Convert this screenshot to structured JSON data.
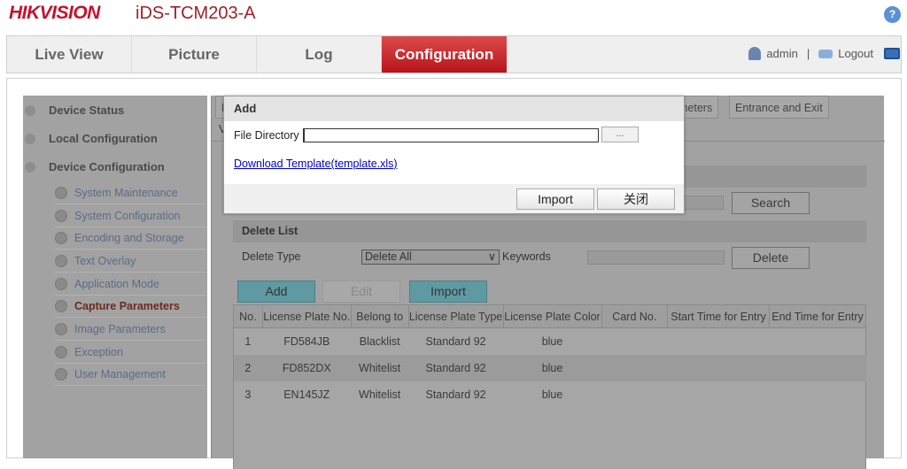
{
  "header": {
    "brand": "HIKVISION",
    "model": "iDS-TCM203-A",
    "help": "?"
  },
  "nav": {
    "tabs": [
      "Live View",
      "Picture",
      "Log",
      "Configuration"
    ],
    "active": "Configuration",
    "user": "admin",
    "separator": "|",
    "logout": "Logout"
  },
  "sidebar": {
    "groups": [
      "Device Status",
      "Local Configuration",
      "Device Configuration"
    ],
    "items": [
      "System Maintenance",
      "System Configuration",
      "Encoding and Storage",
      "Text Overlay",
      "Application Mode",
      "Capture Parameters",
      "Image Parameters",
      "Exception",
      "User Management"
    ],
    "active": "Capture Parameters"
  },
  "main": {
    "tabs": [
      "L",
      "meters",
      "Entrance and Exit"
    ],
    "tab_row2": "V",
    "search_button": "Search",
    "delete_list": {
      "title": "Delete List",
      "delete_type_label": "Delete Type",
      "delete_type_value": "Delete All",
      "keywords_label": "Keywords",
      "delete_button": "Delete"
    },
    "actions": {
      "add": "Add",
      "edit": "Edit",
      "import": "Import"
    },
    "table": {
      "columns": [
        "No.",
        "License Plate No.",
        "Belong to",
        "License Plate Type",
        "License Plate Color",
        "Card No.",
        "Start Time for Entry",
        "End Time for Entry"
      ],
      "rows": [
        [
          "1",
          "FD584JB",
          "Blacklist",
          "Standard 92",
          "blue",
          "",
          "",
          ""
        ],
        [
          "2",
          "FD852DX",
          "Whitelist",
          "Standard 92",
          "blue",
          "",
          "",
          ""
        ],
        [
          "3",
          "EN145JZ",
          "Whitelist",
          "Standard 92",
          "blue",
          "",
          "",
          ""
        ]
      ]
    }
  },
  "modal": {
    "title": "Add",
    "file_directory_label": "File Directory",
    "file_directory_value": "",
    "browse": "...",
    "download_link": "Download Template(template.xls)",
    "import": "Import",
    "close": "关闭"
  },
  "colors": {
    "brand": "#c8102e",
    "active_tab": "#c41a22",
    "link": "#0000cc",
    "action_button": "#5f9aa3"
  }
}
